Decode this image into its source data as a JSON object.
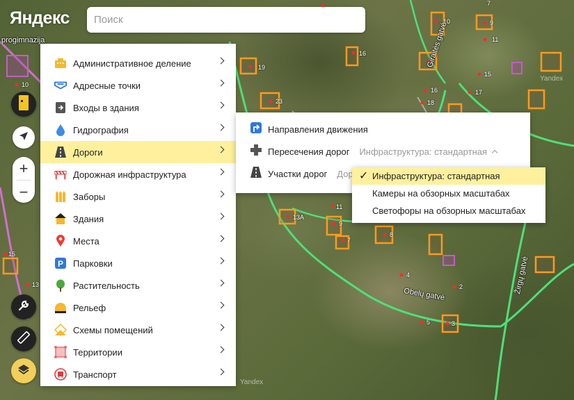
{
  "header": {
    "logo": "Яндекс",
    "search_placeholder": "Поиск",
    "map_corner_label": "progimnazija"
  },
  "map": {
    "street_labels": [
      "Giraitės gatvė",
      "Obelų gatvė",
      "Žirgų gatvė"
    ],
    "watermark": "Yandex",
    "house_numbers": [
      "10",
      "9",
      "7",
      "16",
      "11",
      "19",
      "15",
      "16",
      "17",
      "23",
      "18",
      "11",
      "13А",
      "9",
      "8",
      "7",
      "4",
      "2",
      "5",
      "3",
      "15",
      "13",
      "10"
    ]
  },
  "controls": {
    "zoom_in": "+",
    "zoom_out": "−"
  },
  "layers_menu": {
    "items": [
      {
        "label": "Административное деление",
        "icon": "building-block-icon"
      },
      {
        "label": "Адресные точки",
        "icon": "address-point-icon"
      },
      {
        "label": "Входы в здания",
        "icon": "door-entrance-icon"
      },
      {
        "label": "Гидрография",
        "icon": "water-drop-icon"
      },
      {
        "label": "Дороги",
        "icon": "road-icon"
      },
      {
        "label": "Дорожная инфраструктура",
        "icon": "barrier-icon"
      },
      {
        "label": "Заборы",
        "icon": "fence-icon"
      },
      {
        "label": "Здания",
        "icon": "house-icon"
      },
      {
        "label": "Места",
        "icon": "place-pin-icon"
      },
      {
        "label": "Парковки",
        "icon": "parking-icon"
      },
      {
        "label": "Растительность",
        "icon": "tree-icon"
      },
      {
        "label": "Рельеф",
        "icon": "relief-icon"
      },
      {
        "label": "Схемы помещений",
        "icon": "floor-plan-icon"
      },
      {
        "label": "Территории",
        "icon": "territory-icon"
      },
      {
        "label": "Транспорт",
        "icon": "bus-icon"
      }
    ],
    "active_index": 4
  },
  "roads_submenu": {
    "items": [
      {
        "label": "Направления движения",
        "value": ""
      },
      {
        "label": "Пересечения дорог",
        "value": "Инфраструктура: стандартная"
      },
      {
        "label": "Участки дорог",
        "value": "Дор"
      }
    ]
  },
  "infrastructure_dropdown": {
    "options": [
      "Инфраструктура: стандартная",
      "Камеры на обзорных масштабах",
      "Светофоры на обзорных масштабах"
    ],
    "selected_index": 0,
    "check_mark": "✓"
  },
  "colors": {
    "menu_active_bg": "#fff09d",
    "road_green": "#4ee07a",
    "building_orange": "#ff9a1e"
  }
}
